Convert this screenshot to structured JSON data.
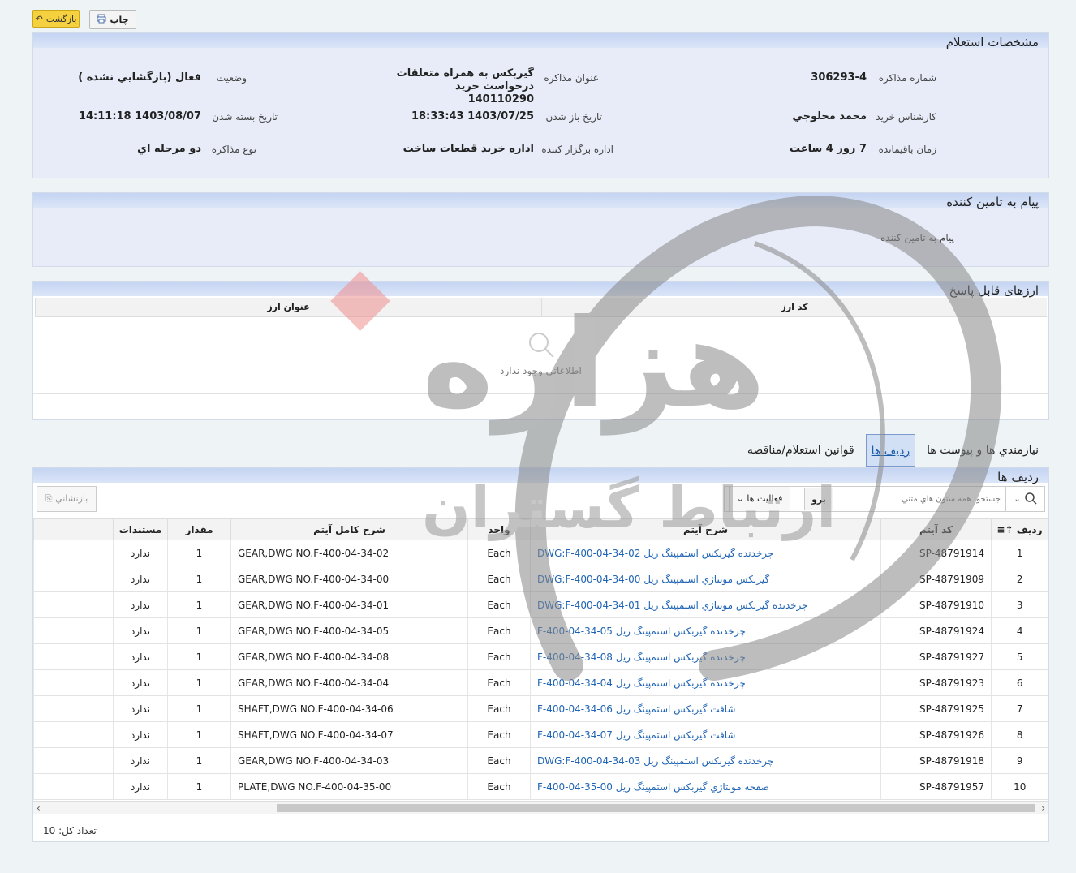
{
  "toolbar": {
    "back_label": "بازگشت",
    "print_label": "چاپ"
  },
  "specs": {
    "title": "مشخصات استعلام",
    "number_label": "شماره مذاکره",
    "number_value": "306293-4",
    "subject_label": "عنوان مذاکره",
    "subject_value": "گیربکس به همراه متعلقات درخواست خرید 140110290",
    "status_label": "وضعيت",
    "status_value": "فعال (بازگشايي نشده )",
    "buyer_label": "کارشناس خريد",
    "buyer_value": "محمد محلوجي",
    "open_label": "تاريخ باز شدن",
    "open_value": "1403/07/25 18:33:43",
    "close_label": "تاريخ بسته شدن",
    "close_value": "1403/08/07 14:11:18",
    "remain_label": "زمان باقيمانده",
    "remain_value": "7 روز 4 ساعت",
    "dept_label": "اداره برگزار کننده",
    "dept_value": "اداره خريد قطعات ساخت",
    "type_label": "نوع مذاکره",
    "type_value": "دو مرحله اي"
  },
  "message": {
    "title": "پيام به تامين کننده",
    "label": "پيام به تامين کننده"
  },
  "currencies": {
    "title": "ارزهای قابل پاسخ",
    "col_code": "کد ارز",
    "col_title": "عنوان ارز",
    "empty": "اطلاعاتي وجود ندارد"
  },
  "tabs": [
    {
      "label": "نيازمندي ها و پيوست ها"
    },
    {
      "label": "رديف ها"
    },
    {
      "label": "قوانين استعلام/مناقصه"
    }
  ],
  "rows": {
    "title": "رديف ها",
    "search_placeholder": "جستجو: همه ستون هاي متني",
    "go_label": "برو",
    "actions_label": "فعاليت ها",
    "reset_label": "بازنشاني",
    "headers": [
      "رديف",
      "کد آيتم",
      "شرح آيتم",
      "واحد",
      "شرح کامل آيتم",
      "مقدار",
      "مستندات"
    ],
    "items": [
      {
        "n": "1",
        "code": "SP-48791914",
        "desc": "DWG:F-400-04-34-02 چرخدنده گیربکس استمپینگ ریل",
        "unit": "Each",
        "full": "GEAR,DWG NO.F-400-04-34-02",
        "qty": "1",
        "docs": "ندارد"
      },
      {
        "n": "2",
        "code": "SP-48791909",
        "desc": "DWG:F-400-04-34-00 گیربکس مونتاژي استمپینگ ریل",
        "unit": "Each",
        "full": "GEAR,DWG NO.F-400-04-34-00",
        "qty": "1",
        "docs": "ندارد"
      },
      {
        "n": "3",
        "code": "SP-48791910",
        "desc": "DWG:F-400-04-34-01 چرخدنده گیربکس مونتاژي استمپینگ ریل",
        "unit": "Each",
        "full": "GEAR,DWG NO.F-400-04-34-01",
        "qty": "1",
        "docs": "ندارد"
      },
      {
        "n": "4",
        "code": "SP-48791924",
        "desc": "F-400-04-34-05 چرخدنده گیربکس استمپینگ ریل",
        "unit": "Each",
        "full": "GEAR,DWG NO.F-400-04-34-05",
        "qty": "1",
        "docs": "ندارد"
      },
      {
        "n": "5",
        "code": "SP-48791927",
        "desc": "F-400-04-34-08 چرخدنده گیربکس استمپینگ ریل",
        "unit": "Each",
        "full": "GEAR,DWG NO.F-400-04-34-08",
        "qty": "1",
        "docs": "ندارد"
      },
      {
        "n": "6",
        "code": "SP-48791923",
        "desc": "F-400-04-34-04 چرخدنده گیربکس استمپینگ ریل",
        "unit": "Each",
        "full": "GEAR,DWG NO.F-400-04-34-04",
        "qty": "1",
        "docs": "ندارد"
      },
      {
        "n": "7",
        "code": "SP-48791925",
        "desc": "F-400-04-34-06 شافت گیربکس استمپینگ ریل",
        "unit": "Each",
        "full": "SHAFT,DWG NO.F-400-04-34-06",
        "qty": "1",
        "docs": "ندارد"
      },
      {
        "n": "8",
        "code": "SP-48791926",
        "desc": "F-400-04-34-07 شافت گیربکس استمپینگ ریل",
        "unit": "Each",
        "full": "SHAFT,DWG NO.F-400-04-34-07",
        "qty": "1",
        "docs": "ندارد"
      },
      {
        "n": "9",
        "code": "SP-48791918",
        "desc": "DWG:F-400-04-34-03 چرخدنده گیربکس استمپینگ ریل",
        "unit": "Each",
        "full": "GEAR,DWG NO.F-400-04-34-03",
        "qty": "1",
        "docs": "ندارد"
      },
      {
        "n": "10",
        "code": "SP-48791957",
        "desc": "F-400-04-35-00 صفحه مونتاژي گیربکس استمپینگ ریل",
        "unit": "Each",
        "full": "PLATE,DWG NO.F-400-04-35-00",
        "qty": "1",
        "docs": "ندارد"
      }
    ],
    "total_label": "تعداد کل: 10"
  },
  "watermark": {
    "text": "هزاره",
    "subtext": "ارتباط گستران"
  }
}
